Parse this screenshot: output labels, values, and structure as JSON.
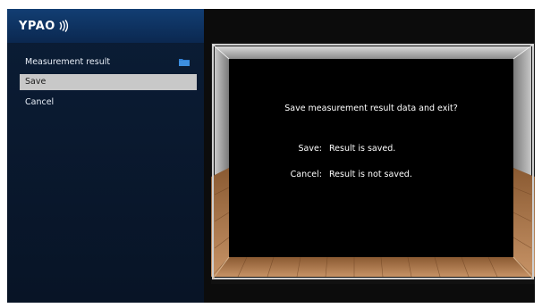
{
  "header": {
    "logo_text": "YPAO"
  },
  "menu": {
    "items": [
      {
        "label": "Measurement result",
        "has_folder_icon": true,
        "selected": false
      },
      {
        "label": "Save",
        "selected": true
      },
      {
        "label": "Cancel",
        "selected": false
      }
    ]
  },
  "dialog": {
    "message": "Save measurement result data and exit?",
    "options": [
      {
        "key": "Save:",
        "value": "Result is saved."
      },
      {
        "key": "Cancel:",
        "value": "Result is not saved."
      }
    ]
  },
  "colors": {
    "sidebar_bg": "#0b1d36",
    "logo_bar": "#123e73",
    "selected_bg": "#c8c8c8",
    "folder_icon": "#2f7fd4",
    "frame_silver": "#a9a9a9",
    "floor_wood": "#b07a4a"
  },
  "icons": {
    "menu_item_1": "folder-icon",
    "logo_mark": "sound-waves-icon"
  }
}
